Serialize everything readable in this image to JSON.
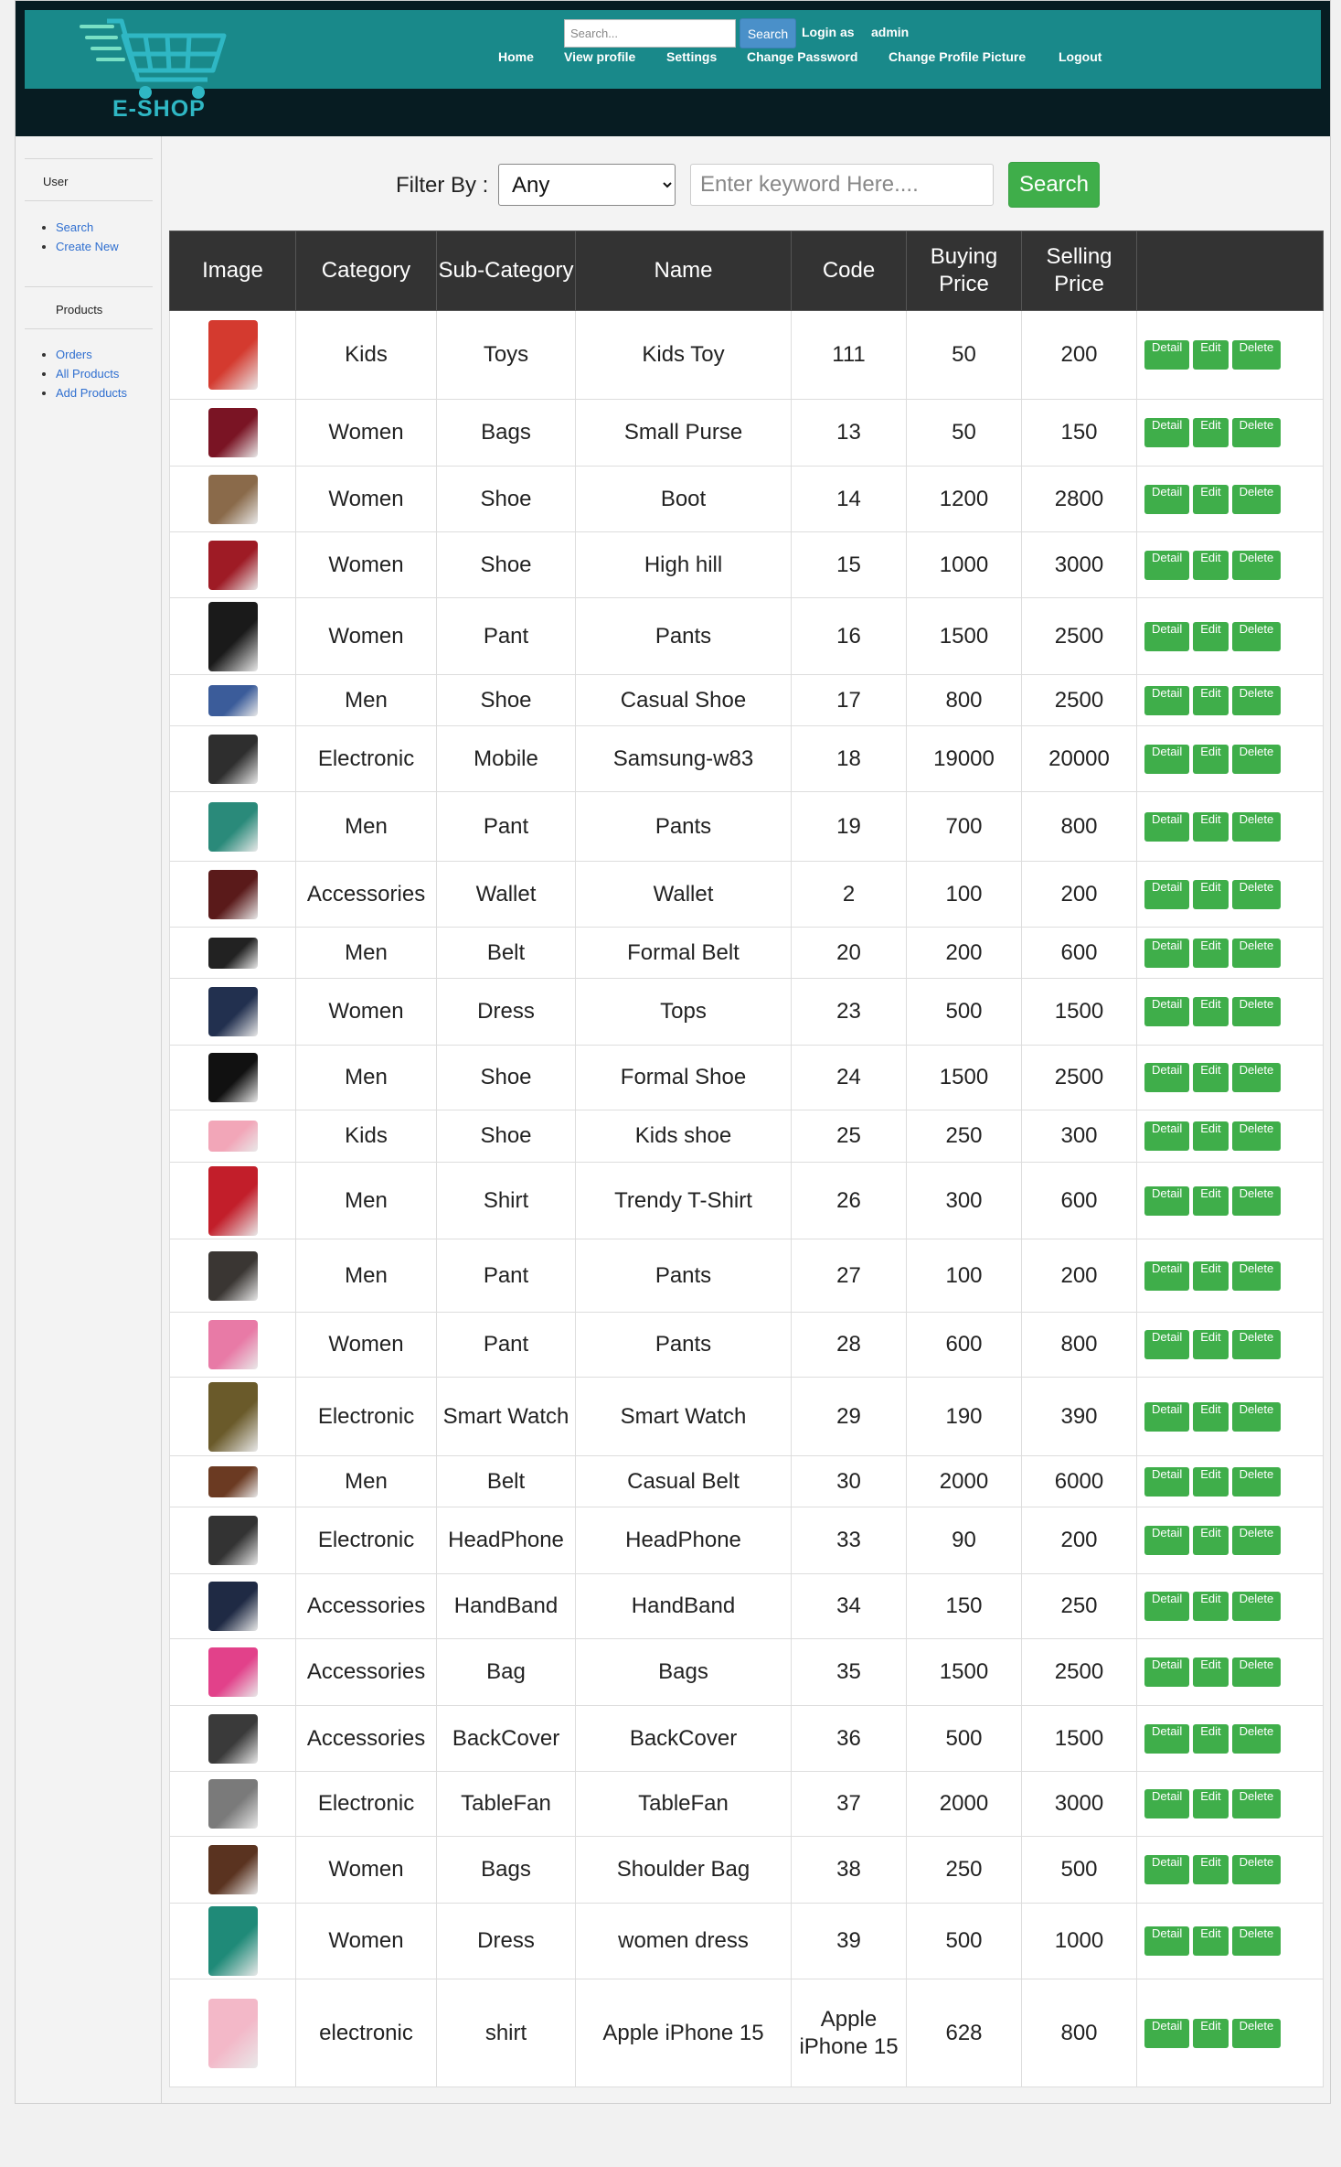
{
  "brand": {
    "name": "E-SHOP"
  },
  "header": {
    "search_placeholder": "Search...",
    "search_button": "Search",
    "login_as": "Login as",
    "username": "admin",
    "nav": [
      "Home",
      "View profile",
      "Settings",
      "Change Password",
      "Change Profile Picture",
      "Logout"
    ]
  },
  "sidebar": {
    "user_title": "User",
    "user_links": [
      "Search",
      "Create New"
    ],
    "products_title": "Products",
    "product_links": [
      "Orders",
      "All Products",
      "Add Products"
    ]
  },
  "filter": {
    "label": "Filter By :",
    "selected": "Any",
    "keyword_placeholder": "Enter keyword Here....",
    "button": "Search"
  },
  "table": {
    "headers": [
      "Image",
      "Category",
      "Sub-Category",
      "Name",
      "Code",
      "Buying Price",
      "Selling Price",
      ""
    ],
    "actions": [
      "Detail",
      "Edit",
      "Delete"
    ],
    "rows": [
      {
        "category": "Kids",
        "subcategory": "Toys",
        "name": "Kids Toy",
        "code": "111",
        "buy": "50",
        "sell": "200",
        "thumb": "toy-image",
        "color": "#d43a2f"
      },
      {
        "category": "Women",
        "subcategory": "Bags",
        "name": "Small Purse",
        "code": "13",
        "buy": "50",
        "sell": "150",
        "thumb": "purse-image",
        "color": "#7a1424"
      },
      {
        "category": "Women",
        "subcategory": "Shoe",
        "name": "Boot",
        "code": "14",
        "buy": "1200",
        "sell": "2800",
        "thumb": "boot-image",
        "color": "#8a6a4a"
      },
      {
        "category": "Women",
        "subcategory": "Shoe",
        "name": "High hill",
        "code": "15",
        "buy": "1000",
        "sell": "3000",
        "thumb": "heels-image",
        "color": "#9e1b25"
      },
      {
        "category": "Women",
        "subcategory": "Pant",
        "name": "Pants",
        "code": "16",
        "buy": "1500",
        "sell": "2500",
        "thumb": "pants-image",
        "color": "#1a1a1a"
      },
      {
        "category": "Men",
        "subcategory": "Shoe",
        "name": "Casual Shoe",
        "code": "17",
        "buy": "800",
        "sell": "2500",
        "thumb": "shoe-image",
        "color": "#3b5c9a"
      },
      {
        "category": "Electronic",
        "subcategory": "Mobile",
        "name": "Samsung-w83",
        "code": "18",
        "buy": "19000",
        "sell": "20000",
        "thumb": "phone-image",
        "color": "#2e2e2e"
      },
      {
        "category": "Men",
        "subcategory": "Pant",
        "name": "Pants",
        "code": "19",
        "buy": "700",
        "sell": "800",
        "thumb": "outfit-image",
        "color": "#2a8a7a"
      },
      {
        "category": "Accessories",
        "subcategory": "Wallet",
        "name": "Wallet",
        "code": "2",
        "buy": "100",
        "sell": "200",
        "thumb": "wallet-image",
        "color": "#5a1a1a"
      },
      {
        "category": "Men",
        "subcategory": "Belt",
        "name": "Formal Belt",
        "code": "20",
        "buy": "200",
        "sell": "600",
        "thumb": "belt-image",
        "color": "#222222"
      },
      {
        "category": "Women",
        "subcategory": "Dress",
        "name": "Tops",
        "code": "23",
        "buy": "500",
        "sell": "1500",
        "thumb": "top-image",
        "color": "#22304f"
      },
      {
        "category": "Men",
        "subcategory": "Shoe",
        "name": "Formal Shoe",
        "code": "24",
        "buy": "1500",
        "sell": "2500",
        "thumb": "formal-shoe-image",
        "color": "#111111"
      },
      {
        "category": "Kids",
        "subcategory": "Shoe",
        "name": "Kids shoe",
        "code": "25",
        "buy": "250",
        "sell": "300",
        "thumb": "kids-shoe-image",
        "color": "#f2a6b8"
      },
      {
        "category": "Men",
        "subcategory": "Shirt",
        "name": "Trendy T-Shirt",
        "code": "26",
        "buy": "300",
        "sell": "600",
        "thumb": "tshirt-image",
        "color": "#c21e2a"
      },
      {
        "category": "Men",
        "subcategory": "Pant",
        "name": "Pants",
        "code": "27",
        "buy": "100",
        "sell": "200",
        "thumb": "trousers-image",
        "color": "#3a3633"
      },
      {
        "category": "Women",
        "subcategory": "Pant",
        "name": "Pants",
        "code": "28",
        "buy": "600",
        "sell": "800",
        "thumb": "pink-pants-image",
        "color": "#e87aa6"
      },
      {
        "category": "Electronic",
        "subcategory": "Smart Watch",
        "name": "Smart Watch",
        "code": "29",
        "buy": "190",
        "sell": "390",
        "thumb": "watch-image",
        "color": "#6a5a2a"
      },
      {
        "category": "Men",
        "subcategory": "Belt",
        "name": "Casual Belt",
        "code": "30",
        "buy": "2000",
        "sell": "6000",
        "thumb": "brown-belt-image",
        "color": "#6b3a22"
      },
      {
        "category": "Electronic",
        "subcategory": "HeadPhone",
        "name": "HeadPhone",
        "code": "33",
        "buy": "90",
        "sell": "200",
        "thumb": "earphone-image",
        "color": "#333333"
      },
      {
        "category": "Accessories",
        "subcategory": "HandBand",
        "name": "HandBand",
        "code": "34",
        "buy": "150",
        "sell": "250",
        "thumb": "handband-image",
        "color": "#1f2a44"
      },
      {
        "category": "Accessories",
        "subcategory": "Bag",
        "name": "Bags",
        "code": "35",
        "buy": "1500",
        "sell": "2500",
        "thumb": "luggage-image",
        "color": "#e2418a"
      },
      {
        "category": "Accessories",
        "subcategory": "BackCover",
        "name": "BackCover",
        "code": "36",
        "buy": "500",
        "sell": "1500",
        "thumb": "backcover-image",
        "color": "#3a3a3a"
      },
      {
        "category": "Electronic",
        "subcategory": "TableFan",
        "name": "TableFan",
        "code": "37",
        "buy": "2000",
        "sell": "3000",
        "thumb": "fan-image",
        "color": "#7a7a7a"
      },
      {
        "category": "Women",
        "subcategory": "Bags",
        "name": "Shoulder Bag",
        "code": "38",
        "buy": "250",
        "sell": "500",
        "thumb": "shoulder-bag-image",
        "color": "#5a3320"
      },
      {
        "category": "Women",
        "subcategory": "Dress",
        "name": "women dress",
        "code": "39",
        "buy": "500",
        "sell": "1000",
        "thumb": "dress-image",
        "color": "#1f8a78"
      },
      {
        "category": "electronic",
        "subcategory": "shirt",
        "name": "Apple iPhone 15",
        "code": "Apple iPhone 15",
        "buy": "628",
        "sell": "800",
        "thumb": "iphone-image",
        "color": "#f3b8c8"
      }
    ]
  }
}
